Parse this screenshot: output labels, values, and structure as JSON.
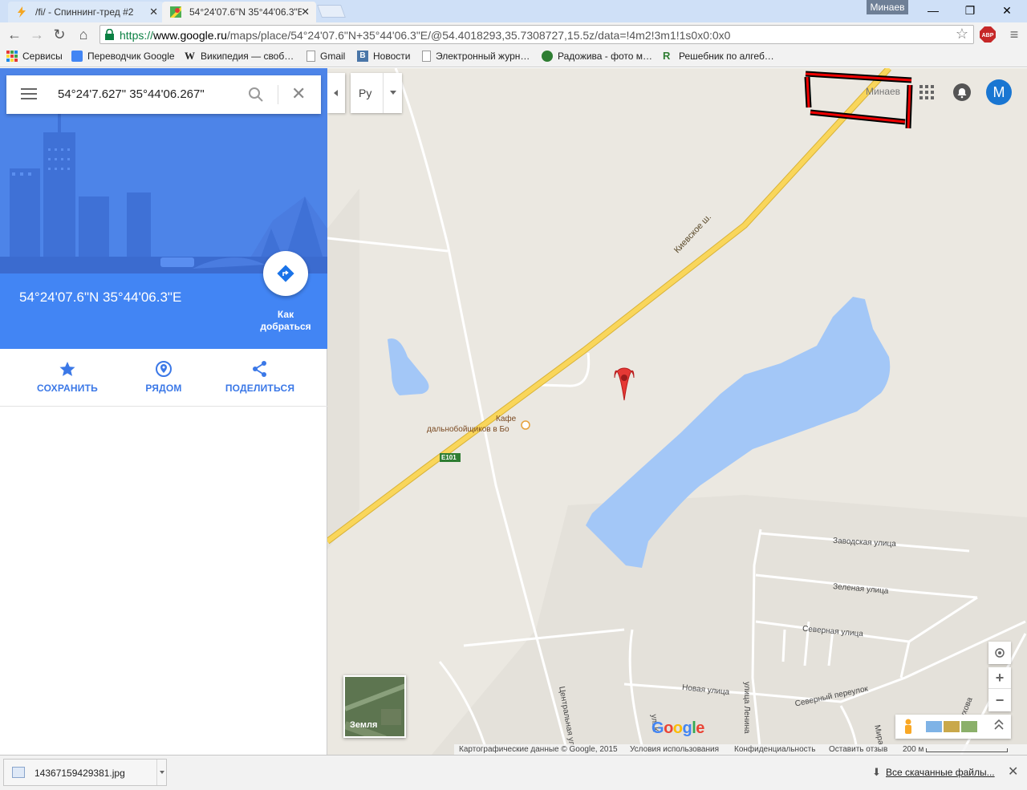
{
  "browser": {
    "tabs": [
      {
        "title": "/fi/ - Спиннинг-тред #2",
        "active": false
      },
      {
        "title": "54°24'07.6\"N 35°44'06.3\"E",
        "active": true
      }
    ],
    "window_user": "Минаев",
    "url_scheme": "https://",
    "url_host": "www.google.ru",
    "url_path": "/maps/place/54°24'07.6\"N+35°44'06.3\"E/@54.4018293,35.7308727,15.5z/data=!4m2!3m1!1s0x0:0x0",
    "ext_label": "ABP",
    "bookmarks": [
      "Сервисы",
      "Переводчик Google",
      "Википедия — своб…",
      "Gmail",
      "Новости",
      "Электронный журн…",
      "Радожива - фото м…",
      "Решебник по алгеб…"
    ]
  },
  "panel": {
    "search_value": "54°24'7.627\" 35°44'06.267\"",
    "place_title": "54°24'07.6\"N 35°44'06.3\"E",
    "directions_label": "Как добраться",
    "actions": [
      {
        "label": "СОХРАНИТЬ",
        "icon": "star-icon"
      },
      {
        "label": "РЯДОМ",
        "icon": "nearby-icon"
      },
      {
        "label": "ПОДЕЛИТЬСЯ",
        "icon": "share-icon"
      }
    ]
  },
  "map": {
    "language": "Ру",
    "account_name": "Минаев",
    "avatar_letter": "M",
    "labels": {
      "highway": "Киевское ш.",
      "cafe_line1": "Кафе",
      "cafe_line2": "дальнобойщиков в Бо",
      "route": "E101",
      "street1": "Заводская улица",
      "street2": "Зеленая улица",
      "street3": "Северная улица",
      "street4": "Новая улица",
      "street5": "Северный переулок",
      "street6": "улица Ленина",
      "street7": "Центральная ул",
      "street8": "Пухова",
      "street9": "Мира",
      "street10": "ул. К"
    },
    "earth_label": "Земля",
    "google_logo": "Google",
    "footer": {
      "copyright": "Картографические данные © Google, 2015",
      "terms": "Условия использования",
      "privacy": "Конфиденциальность",
      "feedback": "Оставить отзыв",
      "scale": "200 м"
    },
    "colors": {
      "land": "#ebe8e1",
      "water": "#a3c7f7",
      "highway": "#f9d65b",
      "marker": "#e53935"
    }
  },
  "downloads": {
    "file": "14367159429381.jpg",
    "show_all": "Все скачанные файлы..."
  }
}
